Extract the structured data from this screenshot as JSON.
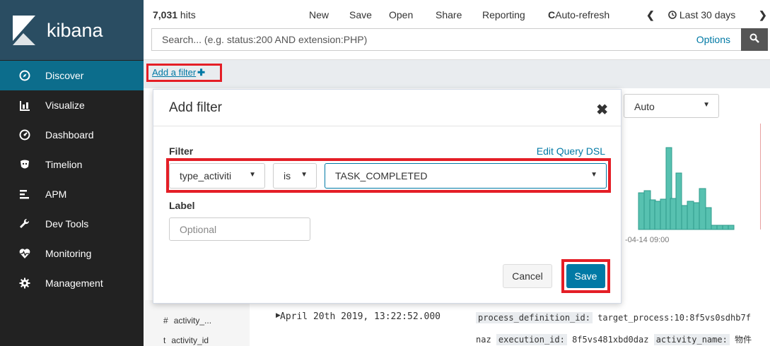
{
  "app": {
    "name": "kibana"
  },
  "sidebar": {
    "items": [
      {
        "label": "Discover",
        "icon": "compass-icon"
      },
      {
        "label": "Visualize",
        "icon": "bar-chart-icon"
      },
      {
        "label": "Dashboard",
        "icon": "dashboard-icon"
      },
      {
        "label": "Timelion",
        "icon": "timelion-icon"
      },
      {
        "label": "APM",
        "icon": "apm-icon"
      },
      {
        "label": "Dev Tools",
        "icon": "wrench-icon"
      },
      {
        "label": "Monitoring",
        "icon": "heartbeat-icon"
      },
      {
        "label": "Management",
        "icon": "gear-icon"
      }
    ]
  },
  "topbar": {
    "hits_count": "7,031",
    "hits_label": " hits",
    "menu": [
      "New",
      "Save",
      "Open",
      "Share",
      "Reporting",
      "Auto-refresh",
      "Last 30 days"
    ],
    "search_placeholder": "Search... (e.g. status:200 AND extension:PHP)",
    "options_label": "Options"
  },
  "filterbar": {
    "add_filter_label": "Add a filter"
  },
  "content": {
    "interval_value": "Auto",
    "chart_date_label": "-04-14 09:00",
    "doc": {
      "field_1": "activity_...",
      "field_2": "activity_id",
      "timestamp": "April 20th 2019, 13:22:52.000",
      "source_line_1_key": "process_definition_id:",
      "source_line_1_value": "target_process:10:8f5vs0sdhb7f",
      "source_line_2_prefix": "naz",
      "source_line_2_key": "execution_id:",
      "source_line_2_value": "8f5vs481xbd0daz",
      "source_line_2_key2": "activity_name:",
      "source_line_2_value2": "物件"
    }
  },
  "modal": {
    "title": "Add filter",
    "filter_label": "Filter",
    "edit_dsl_label": "Edit Query DSL",
    "field_value": "type_activiti",
    "operator_value": "is",
    "value_value": "TASK_COMPLETED",
    "label_label": "Label",
    "label_placeholder": "Optional",
    "cancel_label": "Cancel",
    "save_label": "Save"
  },
  "colors": {
    "sidebar_bg": "#222222",
    "logo_bg": "#2a4d62",
    "active_nav": "#0c6d8c",
    "accent": "#0079a5",
    "highlight_box": "#e41e26",
    "chart_bar": "#57c1b0"
  }
}
